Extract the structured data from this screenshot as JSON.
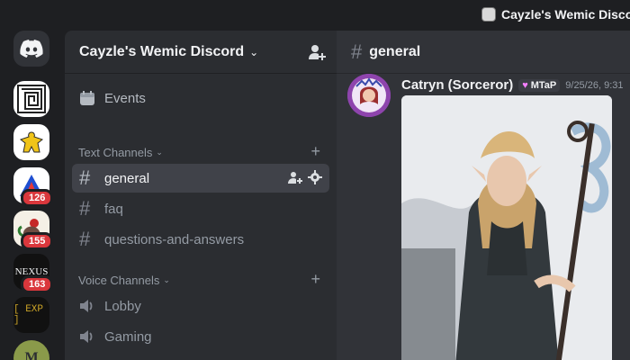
{
  "window": {
    "title": "Cayzle's Wemic Discord"
  },
  "rail": {
    "servers": [
      {
        "name": "Home",
        "icon": "discord-logo-icon"
      },
      {
        "name": "Maze",
        "icon": "maze-icon"
      },
      {
        "name": "Meeple",
        "icon": "meeple-icon"
      },
      {
        "name": "Triangle",
        "icon": "triangle-icon",
        "badge": "126"
      },
      {
        "name": "Rooster",
        "icon": "rooster-icon",
        "badge": "155"
      },
      {
        "name": "Nexus",
        "icon": "nexus-icon",
        "label": "NEXUS",
        "badge": "163"
      },
      {
        "name": "EXP",
        "icon": "exp-icon",
        "label": "[ EXP ]"
      },
      {
        "name": "Green",
        "icon": "letter-m-icon",
        "label": "M"
      }
    ]
  },
  "sidebar": {
    "server_name": "Cayzle's Wemic Discord",
    "events_label": "Events",
    "categories": [
      {
        "label": "Text Channels"
      },
      {
        "label": "Voice Channels"
      }
    ],
    "text_channels": [
      {
        "label": "general",
        "active": true
      },
      {
        "label": "faq"
      },
      {
        "label": "questions-and-answers"
      }
    ],
    "voice_channels": [
      {
        "label": "Lobby"
      },
      {
        "label": "Gaming"
      }
    ]
  },
  "chat": {
    "channel": "general",
    "message": {
      "author": "Catryn (Sorceror)",
      "tag": "MTaP",
      "timestamp": "9/25/26, 9:31"
    }
  },
  "colors": {
    "accent_badge": "#da373c",
    "active_channel": "#404249",
    "tag_heart": "#f47fff"
  }
}
